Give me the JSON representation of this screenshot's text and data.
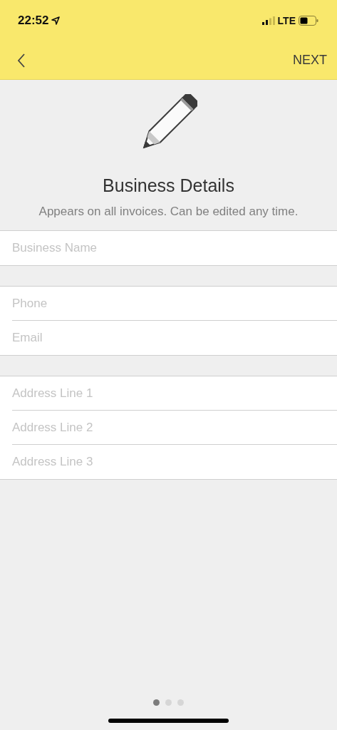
{
  "status_bar": {
    "time": "22:52",
    "network": "LTE"
  },
  "nav": {
    "next": "NEXT"
  },
  "header": {
    "title": "Business Details",
    "subtitle": "Appears on all invoices. Can be edited any time."
  },
  "field_groups": [
    {
      "fields": [
        {
          "placeholder": "Business Name"
        }
      ]
    },
    {
      "fields": [
        {
          "placeholder": "Phone"
        },
        {
          "placeholder": "Email"
        }
      ]
    },
    {
      "fields": [
        {
          "placeholder": "Address Line 1"
        },
        {
          "placeholder": "Address Line 2"
        },
        {
          "placeholder": "Address Line 3"
        }
      ]
    }
  ],
  "page_dots": [
    {
      "selected": true
    },
    {
      "selected": false
    },
    {
      "selected": false
    }
  ]
}
